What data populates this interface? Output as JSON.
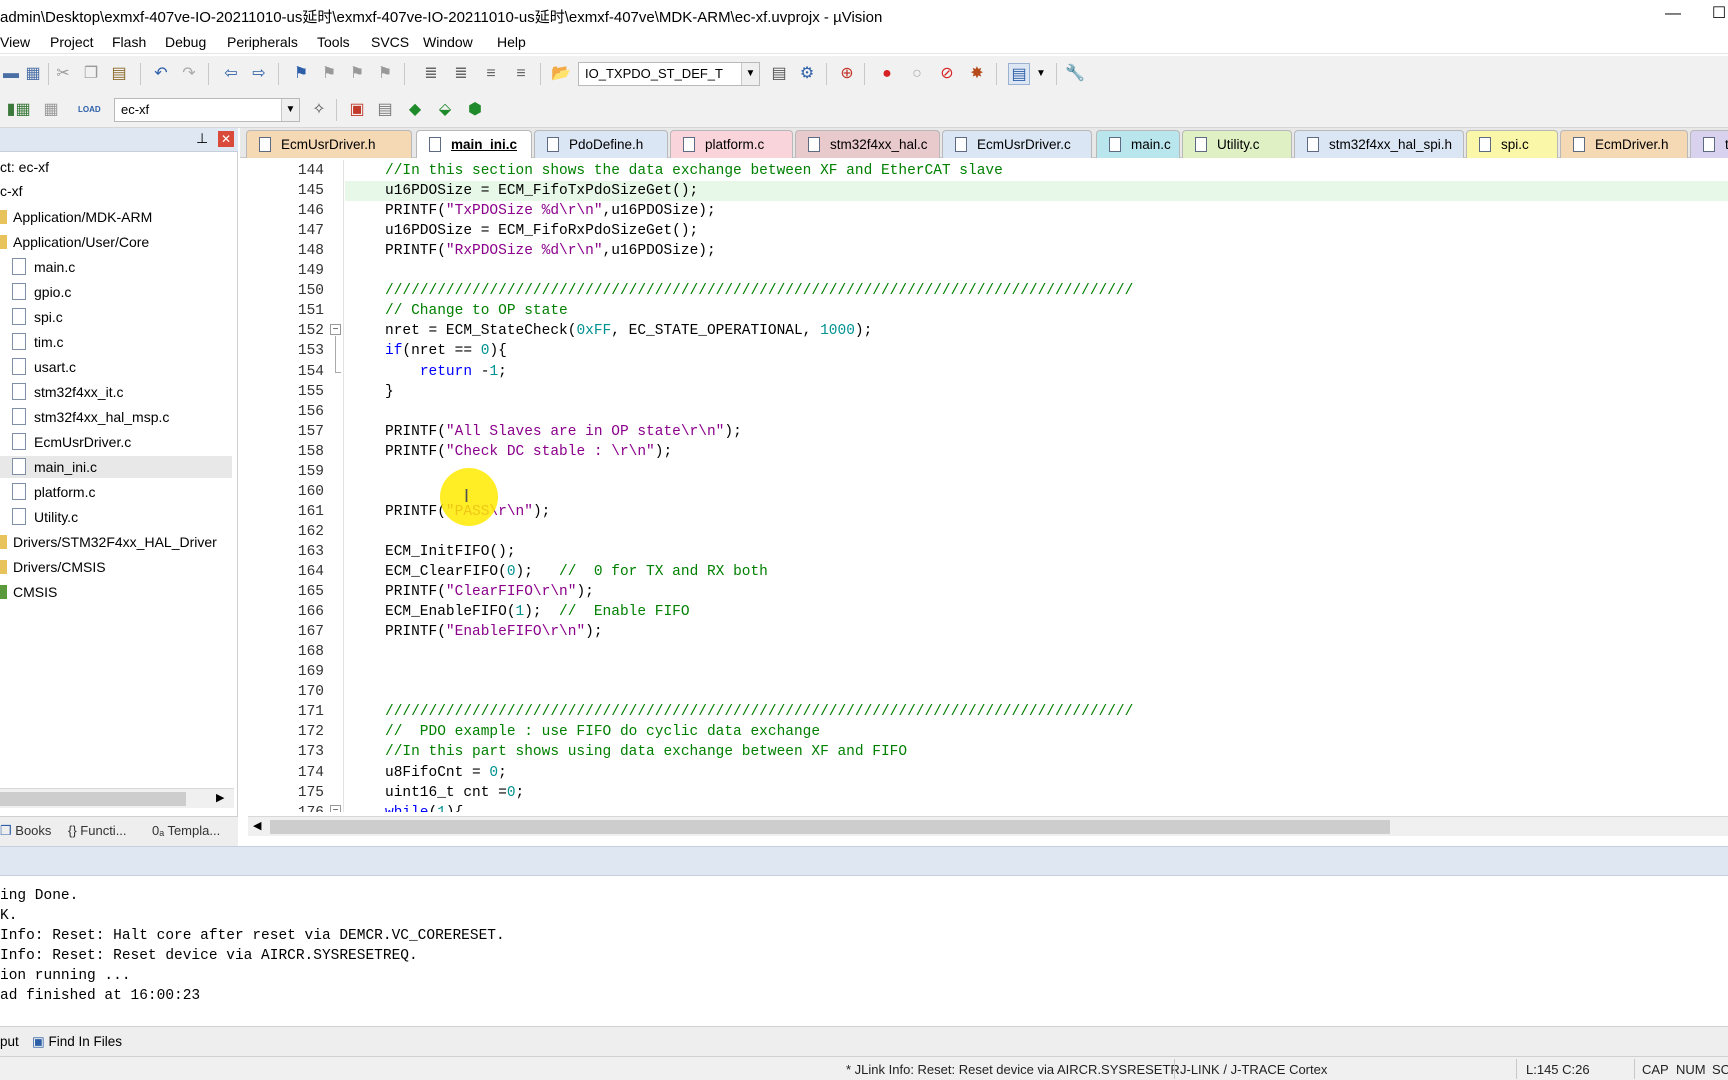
{
  "window": {
    "title": "admin\\Desktop\\exmxf-407ve-IO-20211010-us延时\\exmxf-407ve-IO-20211010-us延时\\exmxf-407ve\\MDK-ARM\\ec-xf.uvprojx - µVision",
    "minimize_glyph": "—",
    "maximize_glyph": "☐"
  },
  "menu": [
    "View",
    "Project",
    "Flash",
    "Debug",
    "Peripherals",
    "Tools",
    "SVCS",
    "Window",
    "Help"
  ],
  "toolbar": {
    "find_combo_value": "IO_TXPDO_ST_DEF_T",
    "target_combo_value": "ec-xf",
    "load_label": "LOAD"
  },
  "project": {
    "root_label": "ct: ec-xf",
    "target_label": "c-xf",
    "items": [
      {
        "label": "Application/MDK-ARM",
        "type": "group"
      },
      {
        "label": "Application/User/Core",
        "type": "group"
      },
      {
        "label": "main.c",
        "type": "file"
      },
      {
        "label": "gpio.c",
        "type": "file"
      },
      {
        "label": "spi.c",
        "type": "file"
      },
      {
        "label": "tim.c",
        "type": "file"
      },
      {
        "label": "usart.c",
        "type": "file"
      },
      {
        "label": "stm32f4xx_it.c",
        "type": "file"
      },
      {
        "label": "stm32f4xx_hal_msp.c",
        "type": "file"
      },
      {
        "label": "EcmUsrDriver.c",
        "type": "file"
      },
      {
        "label": "main_ini.c",
        "type": "file",
        "selected": true
      },
      {
        "label": "platform.c",
        "type": "file"
      },
      {
        "label": "Utility.c",
        "type": "file"
      },
      {
        "label": "Drivers/STM32F4xx_HAL_Driver",
        "type": "group"
      },
      {
        "label": "Drivers/CMSIS",
        "type": "group"
      },
      {
        "label": "CMSIS",
        "type": "group"
      }
    ],
    "tabs": [
      "Books",
      "{} Functi...",
      "0ₐ Templa..."
    ]
  },
  "file_tabs": [
    {
      "label": "EcmUsrDriver.h",
      "color": "#f5d9b5"
    },
    {
      "label": "main_ini.c",
      "color": "#ffffff",
      "active": true
    },
    {
      "label": "PdoDefine.h",
      "color": "#dbe6f5"
    },
    {
      "label": "platform.c",
      "color": "#f9d5db"
    },
    {
      "label": "stm32f4xx_hal.c",
      "color": "#e8c9cc"
    },
    {
      "label": "EcmUsrDriver.c",
      "color": "#dbe6f5"
    },
    {
      "label": "main.c",
      "color": "#b9e6ec"
    },
    {
      "label": "Utility.c",
      "color": "#dff0c4"
    },
    {
      "label": "stm32f4xx_hal_spi.h",
      "color": "#dbe6f5"
    },
    {
      "label": "spi.c",
      "color": "#fbf7a8"
    },
    {
      "label": "EcmDriver.h",
      "color": "#f5d9b5"
    },
    {
      "label": "ti",
      "color": "#d9d2ee"
    }
  ],
  "code": {
    "current_line": 145,
    "lines": [
      {
        "n": "144",
        "segs": [
          [
            "cmt",
            "//In this section shows the data exchange between XF and EtherCAT slave"
          ]
        ]
      },
      {
        "n": "145",
        "segs": [
          [
            "txt",
            "u16PDOSize = ECM_FifoTxPdoSizeGet();"
          ]
        ]
      },
      {
        "n": "146",
        "segs": [
          [
            "txt",
            "PRINTF("
          ],
          [
            "str",
            "\"TxPDOSize %d\\r\\n\""
          ],
          [
            "txt",
            ",u16PDOSize);"
          ]
        ]
      },
      {
        "n": "147",
        "segs": [
          [
            "txt",
            "u16PDOSize = ECM_FifoRxPdoSizeGet();"
          ]
        ]
      },
      {
        "n": "148",
        "segs": [
          [
            "txt",
            "PRINTF("
          ],
          [
            "str",
            "\"RxPDOSize %d\\r\\n\""
          ],
          [
            "txt",
            ",u16PDOSize);"
          ]
        ]
      },
      {
        "n": "149",
        "segs": []
      },
      {
        "n": "150",
        "segs": [
          [
            "cmt",
            "//////////////////////////////////////////////////////////////////////////////////////"
          ]
        ]
      },
      {
        "n": "151",
        "segs": [
          [
            "cmt",
            "// Change to OP state"
          ]
        ]
      },
      {
        "n": "152",
        "segs": [
          [
            "txt",
            "nret = ECM_StateCheck("
          ],
          [
            "num",
            "0xFF"
          ],
          [
            "txt",
            ", EC_STATE_OPERATIONAL, "
          ],
          [
            "num",
            "1000"
          ],
          [
            "txt",
            ");"
          ]
        ]
      },
      {
        "n": "153",
        "segs": [
          [
            "kw",
            "if"
          ],
          [
            "txt",
            "(nret == "
          ],
          [
            "num",
            "0"
          ],
          [
            "txt",
            "){"
          ]
        ]
      },
      {
        "n": "154",
        "segs": [
          [
            "txt",
            "    "
          ],
          [
            "kw",
            "return"
          ],
          [
            "txt",
            " -"
          ],
          [
            "num",
            "1"
          ],
          [
            "txt",
            ";"
          ]
        ]
      },
      {
        "n": "155",
        "segs": [
          [
            "txt",
            "}"
          ]
        ]
      },
      {
        "n": "156",
        "segs": []
      },
      {
        "n": "157",
        "segs": [
          [
            "txt",
            "PRINTF("
          ],
          [
            "str",
            "\"All Slaves are in OP state\\r\\n\""
          ],
          [
            "txt",
            ");"
          ]
        ]
      },
      {
        "n": "158",
        "segs": [
          [
            "txt",
            "PRINTF("
          ],
          [
            "str",
            "\"Check DC stable : \\r\\n\""
          ],
          [
            "txt",
            ");"
          ]
        ]
      },
      {
        "n": "159",
        "segs": []
      },
      {
        "n": "160",
        "segs": []
      },
      {
        "n": "161",
        "segs": [
          [
            "txt",
            "PRINTF("
          ],
          [
            "str",
            "\"PASS\\r\\n\""
          ],
          [
            "txt",
            ");"
          ]
        ]
      },
      {
        "n": "162",
        "segs": []
      },
      {
        "n": "163",
        "segs": [
          [
            "txt",
            "ECM_InitFIFO();"
          ]
        ]
      },
      {
        "n": "164",
        "segs": [
          [
            "txt",
            "ECM_ClearFIFO("
          ],
          [
            "num",
            "0"
          ],
          [
            "txt",
            ");   "
          ],
          [
            "cmt",
            "//  0 for TX and RX both"
          ]
        ]
      },
      {
        "n": "165",
        "segs": [
          [
            "txt",
            "PRINTF("
          ],
          [
            "str",
            "\"ClearFIFO\\r\\n\""
          ],
          [
            "txt",
            ");"
          ]
        ]
      },
      {
        "n": "166",
        "segs": [
          [
            "txt",
            "ECM_EnableFIFO("
          ],
          [
            "num",
            "1"
          ],
          [
            "txt",
            ");  "
          ],
          [
            "cmt",
            "//  Enable FIFO"
          ]
        ]
      },
      {
        "n": "167",
        "segs": [
          [
            "txt",
            "PRINTF("
          ],
          [
            "str",
            "\"EnableFIFO\\r\\n\""
          ],
          [
            "txt",
            ");"
          ]
        ]
      },
      {
        "n": "168",
        "segs": []
      },
      {
        "n": "169",
        "segs": []
      },
      {
        "n": "170",
        "segs": []
      },
      {
        "n": "171",
        "segs": [
          [
            "cmt",
            "//////////////////////////////////////////////////////////////////////////////////////"
          ]
        ]
      },
      {
        "n": "172",
        "segs": [
          [
            "cmt",
            "//  PDO example : use FIFO do cyclic data exchange"
          ]
        ]
      },
      {
        "n": "173",
        "segs": [
          [
            "cmt",
            "//In this part shows using data exchange between XF and FIFO"
          ]
        ]
      },
      {
        "n": "174",
        "segs": [
          [
            "txt",
            "u8FifoCnt = "
          ],
          [
            "num",
            "0"
          ],
          [
            "txt",
            ";"
          ]
        ]
      },
      {
        "n": "175",
        "segs": [
          [
            "txt",
            "uint16_t cnt ="
          ],
          [
            "num",
            "0"
          ],
          [
            "txt",
            ";"
          ]
        ]
      },
      {
        "n": "176",
        "segs": [
          [
            "kw",
            "while"
          ],
          [
            "txt",
            "("
          ],
          [
            "num",
            "1"
          ],
          [
            "txt",
            "){"
          ]
        ]
      }
    ]
  },
  "output": {
    "lines": [
      "ing Done.",
      "K.",
      "Info: Reset: Halt core after reset via DEMCR.VC_CORERESET.",
      "Info: Reset: Reset device via AIRCR.SYSRESETREQ.",
      "ion running ...",
      "ad finished at 16:00:23"
    ],
    "tabs": [
      "put",
      "Find In Files"
    ]
  },
  "status": {
    "message": "* JLink Info: Reset: Reset device via AIRCR.SYSRESETR",
    "debugger": "J-LINK / J-TRACE Cortex",
    "position": "L:145 C:26",
    "caps": "CAP",
    "num": "NUM",
    "scrl": "SC"
  },
  "colors": {
    "comment": "#008000",
    "string": "#8b008b",
    "number": "#009191",
    "keyword": "#0000ff",
    "current_line_bg": "#e8f8e8",
    "cursor_highlight": "#ffea00"
  }
}
